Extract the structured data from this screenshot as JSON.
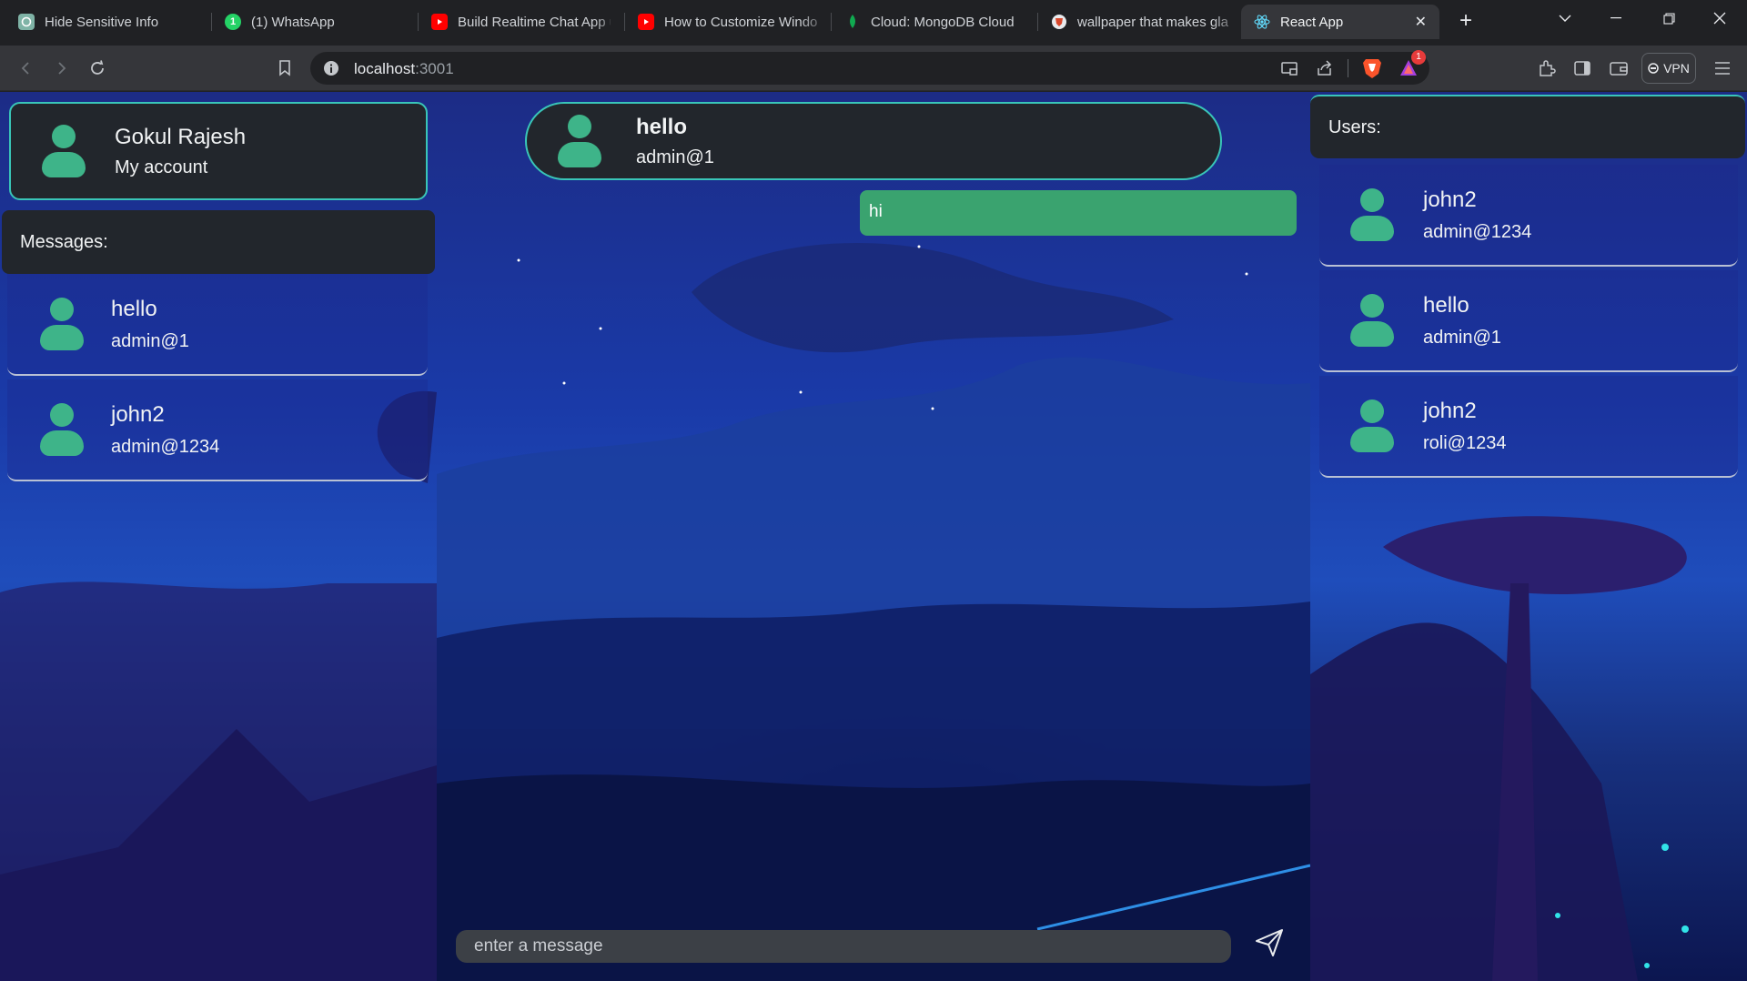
{
  "browser": {
    "tabs": [
      {
        "title": "Hide Sensitive Info",
        "favicon": "chatgpt-icon",
        "color": "#7fb3a6"
      },
      {
        "title": "(1) WhatsApp",
        "favicon": "whatsapp-icon",
        "color": "#25d366"
      },
      {
        "title": "Build Realtime Chat App u",
        "favicon": "youtube-icon",
        "color": "#ff0000"
      },
      {
        "title": "How to Customize Windo",
        "favicon": "youtube-icon",
        "color": "#ff0000"
      },
      {
        "title": "Cloud: MongoDB Cloud",
        "favicon": "mongodb-leaf-icon",
        "color": "#10aa50"
      },
      {
        "title": "wallpaper that makes gla",
        "favicon": "brave-search-icon",
        "color": "#e8eaed"
      },
      {
        "title": "React App",
        "favicon": "react-icon",
        "color": "#61dafb",
        "active": true
      }
    ],
    "address": {
      "host": "localhost",
      "port": ":3001"
    },
    "notification_count": "1",
    "vpn_label": "VPN"
  },
  "app": {
    "account": {
      "name": "Gokul Rajesh",
      "subtitle": "My account"
    },
    "messages_heading": "Messages:",
    "conversations": [
      {
        "name": "hello",
        "email": "admin@1"
      },
      {
        "name": "john2",
        "email": "admin@1234"
      }
    ],
    "chat": {
      "header": {
        "name": "hello",
        "email": "admin@1"
      },
      "messages": [
        {
          "text": "hi",
          "direction": "sent"
        }
      ],
      "input_placeholder": "enter a message"
    },
    "users_heading": "Users:",
    "users": [
      {
        "name": "john2",
        "email": "admin@1234"
      },
      {
        "name": "hello",
        "email": "admin@1"
      },
      {
        "name": "john2",
        "email": "roli@1234"
      }
    ],
    "colors": {
      "accent": "#39c5b8",
      "avatar": "#3eb489",
      "sent_bubble": "#3aa36f",
      "panel": "#22262c"
    }
  }
}
